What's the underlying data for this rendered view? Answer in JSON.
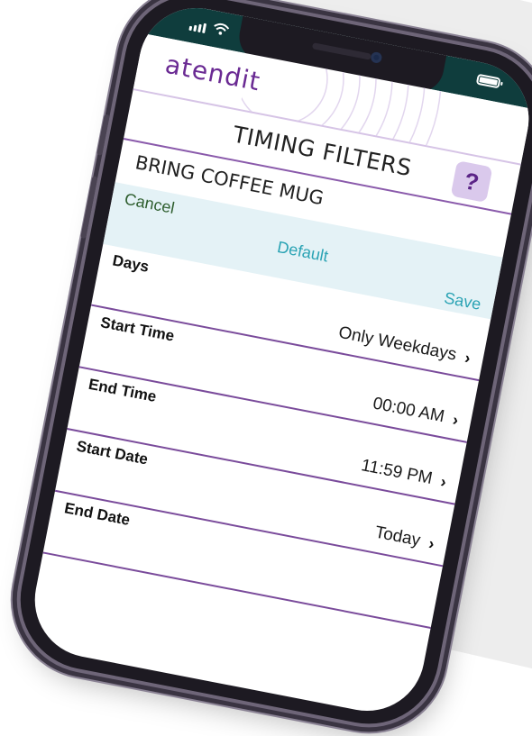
{
  "status_bar": {
    "battery_icon": "battery-icon",
    "signal_icon": "signal-icon",
    "wifi_icon": "wifi-icon"
  },
  "app": {
    "logo_text": "atendit",
    "brand_color": "#6a2a93",
    "accent_color": "#2aa3b4"
  },
  "header": {
    "title": "TIMING FILTERS",
    "help_label": "?"
  },
  "item": {
    "title": "BRING COFFEE MUG"
  },
  "actions": {
    "cancel": "Cancel",
    "default": "Default",
    "save": "Save"
  },
  "rows": [
    {
      "label": "Days",
      "value": "Only Weekdays"
    },
    {
      "label": "Start Time",
      "value": "00:00 AM"
    },
    {
      "label": "End Time",
      "value": "11:59 PM"
    },
    {
      "label": "Start Date",
      "value": "Today"
    },
    {
      "label": "End Date",
      "value": ""
    }
  ]
}
